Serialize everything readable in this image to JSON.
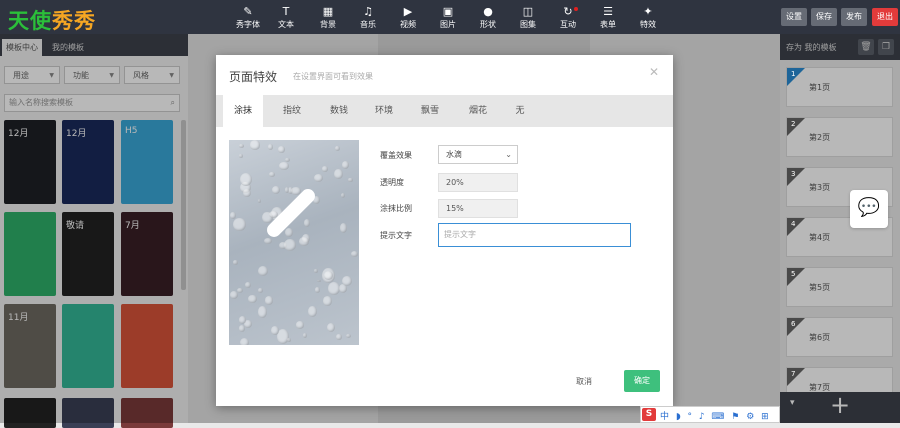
{
  "app": {
    "logo_a": "天使",
    "logo_b": "秀秀"
  },
  "toolbar": [
    {
      "label": "秀字体",
      "icon": "pen-icon",
      "glyph": "✎"
    },
    {
      "label": "文本",
      "icon": "text-icon",
      "glyph": "T"
    },
    {
      "label": "背景",
      "icon": "background-icon",
      "glyph": "▦"
    },
    {
      "label": "音乐",
      "icon": "music-icon",
      "glyph": "♫"
    },
    {
      "label": "视频",
      "icon": "video-icon",
      "glyph": "▶"
    },
    {
      "label": "图片",
      "icon": "image-icon",
      "glyph": "▣"
    },
    {
      "label": "形状",
      "icon": "shape-icon",
      "glyph": "●"
    },
    {
      "label": "图集",
      "icon": "gallery-icon",
      "glyph": "◫"
    },
    {
      "label": "互动",
      "icon": "interact-icon",
      "glyph": "↻"
    },
    {
      "label": "表单",
      "icon": "form-icon",
      "glyph": "☰"
    },
    {
      "label": "特效",
      "icon": "effect-icon",
      "glyph": "✦"
    }
  ],
  "top_actions": {
    "settings": "设置",
    "save": "保存",
    "publish": "发布",
    "exit": "退出"
  },
  "left_panel": {
    "tab_center": "模板中心",
    "tab_mine": "我的模板",
    "filters": [
      "用途",
      "功能",
      "风格"
    ],
    "search_placeholder": "输入名称搜索模板",
    "thumbs": [
      {
        "title": "12月",
        "color": "#1e2126"
      },
      {
        "title": "12月",
        "color": "#1a2a5c"
      },
      {
        "title": "H5",
        "color": "#3aa8d8"
      },
      {
        "title": "",
        "color": "#2fb06a"
      },
      {
        "title": "敬请",
        "color": "#222222"
      },
      {
        "title": "7月",
        "color": "#3a1f26"
      },
      {
        "title": "11月",
        "color": "#6e6a62"
      },
      {
        "title": "",
        "color": "#34b898"
      },
      {
        "title": "",
        "color": "#d9543a"
      }
    ]
  },
  "right_panel": {
    "header": "存为 我的模板",
    "pages": [
      {
        "num": "1",
        "label": "第1页"
      },
      {
        "num": "2",
        "label": "第2页"
      },
      {
        "num": "3",
        "label": "第3页"
      },
      {
        "num": "4",
        "label": "第4页"
      },
      {
        "num": "5",
        "label": "第5页"
      },
      {
        "num": "6",
        "label": "第6页"
      },
      {
        "num": "7",
        "label": "第7页"
      }
    ]
  },
  "modal": {
    "title": "页面特效",
    "hint": "在设置界面可看到效果",
    "tabs": [
      "涂抹",
      "指纹",
      "数钱",
      "环境",
      "飘雪",
      "烟花",
      "无"
    ],
    "active_tab": "涂抹",
    "fields": {
      "cover_label": "覆盖效果",
      "cover_value": "水滴",
      "opacity_label": "透明度",
      "opacity_value": "20%",
      "ratio_label": "涂抹比例",
      "ratio_value": "15%",
      "prompt_label": "提示文字",
      "prompt_placeholder": "提示文字"
    },
    "cancel": "取消",
    "confirm": "确定"
  },
  "ime": {
    "logo": "S",
    "label": "中 ◗ ° ♪ ⌨ ⚑ ⚙ ⊞"
  }
}
